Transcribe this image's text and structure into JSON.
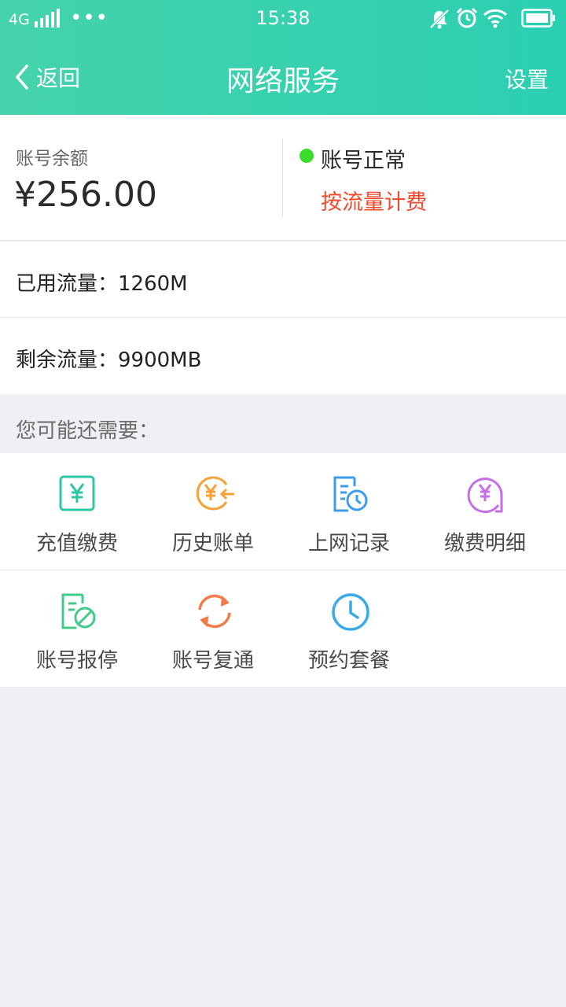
{
  "status_bar": {
    "network": "4G",
    "time": "15:38",
    "dots": "•••",
    "icons": [
      "signal-icon",
      "more-dots-icon",
      "mute-icon",
      "alarm-icon",
      "wifi-icon",
      "battery-icon"
    ]
  },
  "nav": {
    "back_label": "返回",
    "title": "网络服务",
    "settings_label": "设置"
  },
  "account": {
    "balance_label": "账号余额",
    "balance_amount": "¥256.00",
    "status_text": "账号正常",
    "billing_mode": "按流量计费",
    "status_color": "#3adb2a",
    "billing_color": "#ef4a2d"
  },
  "usage": {
    "used": "已用流量：1260M",
    "remaining": "剩余流量：9900MB"
  },
  "suggest": {
    "label": "您可能还需要："
  },
  "actions": [
    {
      "label": "充值缴费",
      "icon": "recharge-icon",
      "color": "#2ec7a6"
    },
    {
      "label": "历史账单",
      "icon": "history-bill-icon",
      "color": "#f7a136"
    },
    {
      "label": "上网记录",
      "icon": "internet-record-icon",
      "color": "#3b9cf0"
    },
    {
      "label": "缴费明细",
      "icon": "payment-detail-icon",
      "color": "#c56ee8"
    },
    {
      "label": "账号报停",
      "icon": "account-suspend-icon",
      "color": "#3fcc88"
    },
    {
      "label": "账号复通",
      "icon": "account-restore-icon",
      "color": "#f47a4a"
    },
    {
      "label": "预约套餐",
      "icon": "reserve-plan-icon",
      "color": "#3aabe8"
    }
  ],
  "theme": {
    "header_start": "#45d3ab",
    "header_end": "#2ccfb2",
    "background": "#efeff4"
  }
}
